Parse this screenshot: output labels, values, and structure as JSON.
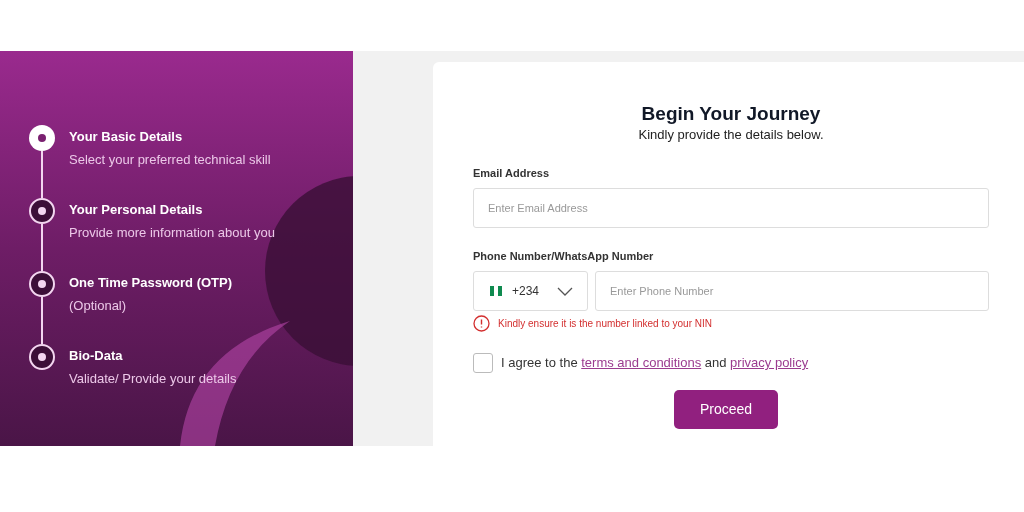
{
  "steps": [
    {
      "title": "Your Basic Details",
      "subtitle": "Select your preferred technical skill",
      "selected": true
    },
    {
      "title": "Your Personal Details",
      "subtitle": "Provide more information about you",
      "selected": false
    },
    {
      "title": "One Time Password (OTP)",
      "subtitle": "(Optional)",
      "selected": false
    },
    {
      "title": "Bio-Data",
      "subtitle": "Validate/ Provide your details",
      "selected": false
    }
  ],
  "form": {
    "title": "Begin Your Journey",
    "subtitle": "Kindly provide the details below.",
    "email": {
      "label": "Email Address",
      "placeholder": "Enter Email Address"
    },
    "phone": {
      "label": "Phone Number/WhatsApp Number",
      "code": "+234",
      "placeholder": "Enter Phone Number",
      "warning": "Kindly ensure it is the number linked to your NIN"
    },
    "agree": {
      "checked": false,
      "before": "I agree to the ",
      "link_1": "terms and conditions",
      "middle": " and ",
      "link_2": "privacy policy"
    },
    "submit": "Proceed"
  }
}
